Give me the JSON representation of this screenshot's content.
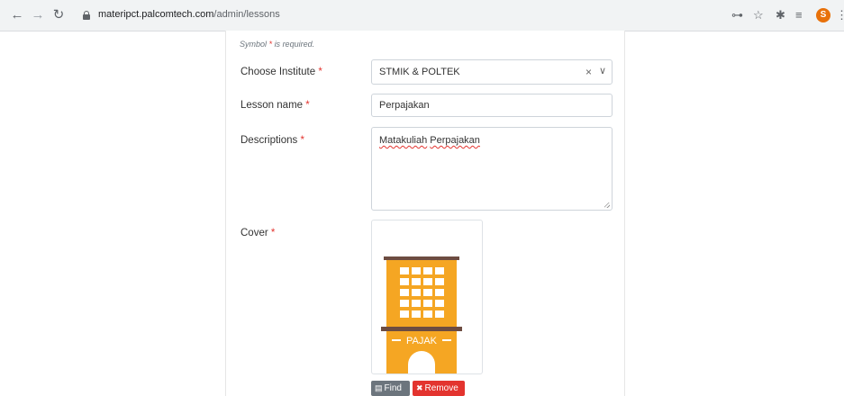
{
  "browser": {
    "url_host": "materipct.palcomtech.com",
    "url_path": "/admin/lessons",
    "profile_initial": "S"
  },
  "form": {
    "hint_prefix": "Symbol",
    "required_mark": "*",
    "hint_suffix": "is required.",
    "institute": {
      "label": "Choose Institute",
      "value": "STMIK & POLTEK"
    },
    "lesson": {
      "label": "Lesson name",
      "value": "Perpajakan"
    },
    "descriptions": {
      "label": "Descriptions",
      "value_word1": "Matakuliah",
      "value_word2": "Perpajakan"
    },
    "cover": {
      "label": "Cover",
      "image_text": "PAJAK"
    },
    "find_label": "Find",
    "remove_label": "Remove"
  },
  "colors": {
    "required": "#e3342f",
    "building": "#f5a623",
    "find_button": "#6c757d",
    "remove_button": "#e3342f"
  }
}
